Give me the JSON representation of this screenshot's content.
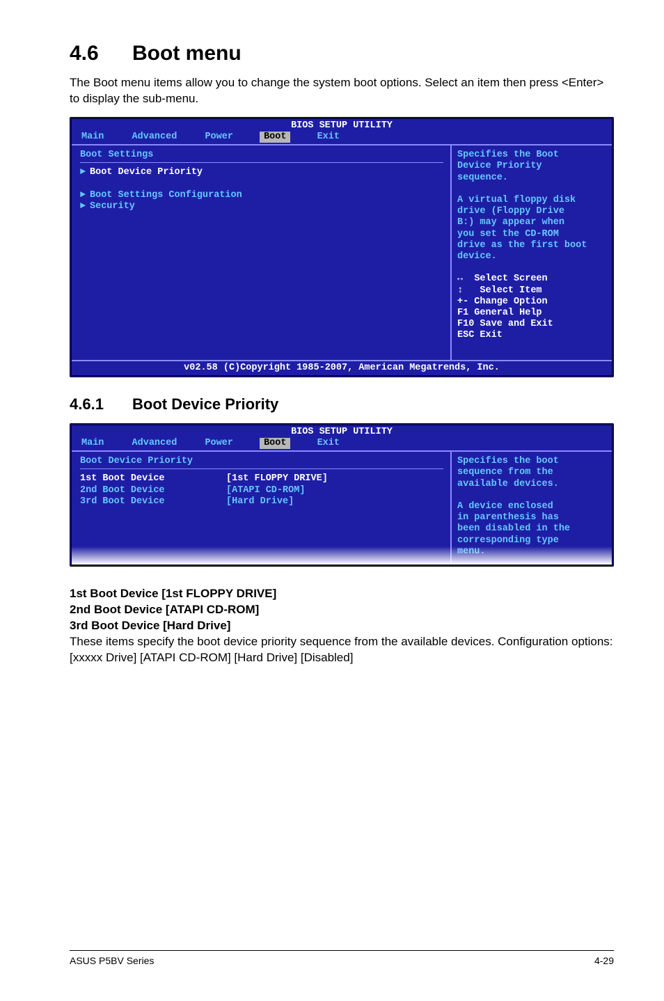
{
  "section": {
    "number": "4.6",
    "title": "Boot menu"
  },
  "intro": "The Boot menu items allow you to change the system boot options. Select an item then press <Enter> to display the sub-menu.",
  "bios1": {
    "title": "BIOS SETUP UTILITY",
    "tabs": [
      "Main",
      "Advanced",
      "Power",
      "Boot",
      "Exit"
    ],
    "active_tab": "Boot",
    "heading": "Boot Settings",
    "items": {
      "selected": "Boot Device Priority",
      "cfg": "Boot Settings Configuration",
      "sec": "Security"
    },
    "help": {
      "l1": "Specifies the Boot",
      "l2": "Device Priority",
      "l3": "sequence.",
      "l4": "A virtual floppy disk",
      "l5": "drive (Floppy Drive",
      "l6": "B:) may appear when",
      "l7": "you set the CD-ROM",
      "l8": "drive as the first boot",
      "l9": "device."
    },
    "legend": {
      "select_screen": "Select Screen",
      "select_item": "Select Item",
      "change_option": "+-  Change Option",
      "general_help": "F1  General Help",
      "save_exit": "F10 Save and Exit",
      "esc": "ESC Exit"
    },
    "footer": "v02.58 (C)Copyright 1985-2007, American Megatrends, Inc."
  },
  "subsection": {
    "number": "4.6.1",
    "title": "Boot Device Priority"
  },
  "bios2": {
    "title": "BIOS SETUP UTILITY",
    "tabs": [
      "Main",
      "Advanced",
      "Power",
      "Boot",
      "Exit"
    ],
    "active_tab": "Boot",
    "heading": "Boot Device Priority",
    "rows": {
      "r1_label": "1st Boot Device",
      "r1_value": "[1st FLOPPY DRIVE]",
      "r2_label": "2nd Boot Device",
      "r2_value": "[ATAPI CD-ROM]",
      "r3_label": "3rd Boot Device",
      "r3_value": "[Hard Drive]"
    },
    "help": {
      "l1": "Specifies the boot",
      "l2": "sequence from the",
      "l3": "available devices.",
      "l4": "A device enclosed",
      "l5": "in parenthesis has",
      "l6": "been disabled in the",
      "l7": "corresponding type",
      "l8": "menu."
    }
  },
  "options": {
    "o1": "1st Boot Device [1st FLOPPY DRIVE]",
    "o2": "2nd Boot Device [ATAPI CD-ROM]",
    "o3": "3rd Boot Device [Hard Drive]"
  },
  "desc": "These items specify the boot device priority sequence from the available devices. Configuration options: [xxxxx Drive] [ATAPI CD-ROM] [Hard Drive] [Disabled]",
  "footer": {
    "left": "ASUS P5BV Series",
    "right": "4-29"
  }
}
